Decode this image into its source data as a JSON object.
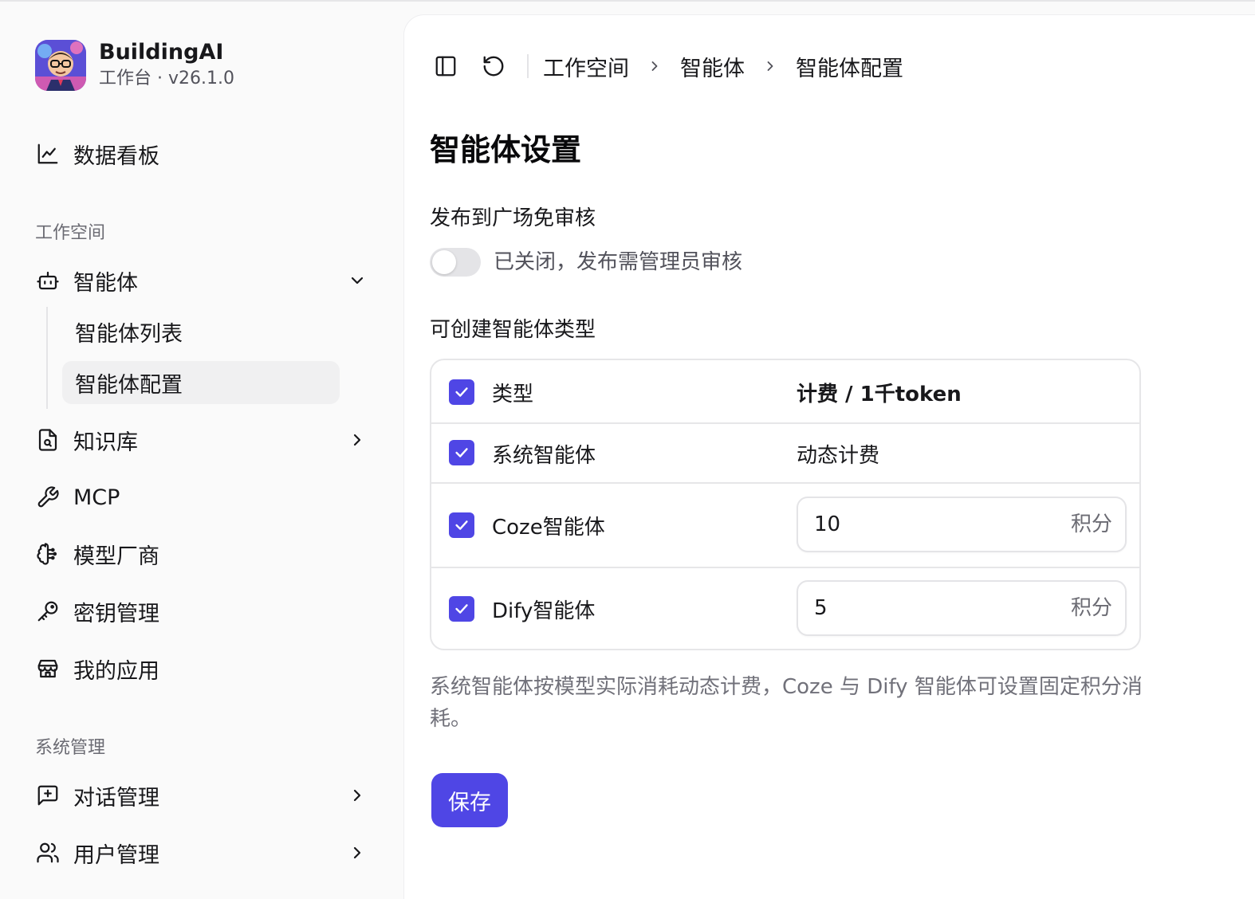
{
  "brand": {
    "name": "BuildingAI",
    "subtitle": "工作台 · v26.1.0"
  },
  "sidebar": {
    "dashboard": "数据看板",
    "workspace_label": "工作空间",
    "agents": {
      "label": "智能体",
      "children": [
        "智能体列表",
        "智能体配置"
      ]
    },
    "knowledge": "知识库",
    "mcp": "MCP",
    "models": "模型厂商",
    "keys": "密钥管理",
    "apps": "我的应用",
    "system_label": "系统管理",
    "conversations": "对话管理",
    "users": "用户管理"
  },
  "breadcrumb": [
    "工作空间",
    "智能体",
    "智能体配置"
  ],
  "page": {
    "title": "智能体设置",
    "publish_label": "发布到广场免审核",
    "toggle_text": "已关闭，发布需管理员审核",
    "types_label": "可创建智能体类型",
    "table": {
      "header_type": "类型",
      "header_cost": "计费 / 1千token",
      "rows": [
        {
          "name": "系统智能体",
          "value": "动态计费"
        },
        {
          "name": "Coze智能体",
          "value": "10",
          "unit": "积分"
        },
        {
          "name": "Dify智能体",
          "value": "5",
          "unit": "积分"
        }
      ]
    },
    "help_text": "系统智能体按模型实际消耗动态计费，Coze 与 Dify 智能体可设置固定积分消耗。",
    "save_label": "保存"
  },
  "colors": {
    "accent": "#4f46e5",
    "active_bg": "#f0f0f1"
  }
}
